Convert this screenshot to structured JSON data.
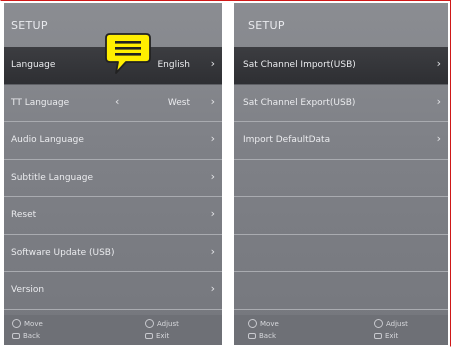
{
  "left_panel": {
    "title": "SETUP",
    "rows": [
      {
        "label": "Language",
        "value": "English",
        "selected": true
      },
      {
        "label": "TT Language",
        "value": "West",
        "selected": false
      },
      {
        "label": "Audio Language",
        "value": "",
        "selected": false
      },
      {
        "label": "Subtitle Language",
        "value": "",
        "selected": false
      },
      {
        "label": "Reset",
        "value": "",
        "selected": false
      },
      {
        "label": "Software Update (USB)",
        "value": "",
        "selected": false
      },
      {
        "label": "Version",
        "value": "",
        "selected": false
      }
    ],
    "footer": {
      "move": "Move",
      "adjust": "Adjust",
      "back": "Back",
      "exit": "Exit"
    }
  },
  "right_panel": {
    "title": "SETUP",
    "rows": [
      {
        "label": "Sat Channel Import(USB)"
      },
      {
        "label": "Sat Channel Export(USB)"
      },
      {
        "label": "Import DefaultData"
      },
      {
        "label": ""
      },
      {
        "label": ""
      },
      {
        "label": ""
      },
      {
        "label": ""
      }
    ],
    "footer": {
      "move": "Move",
      "adjust": "Adjust",
      "back": "Back",
      "exit": "Exit"
    }
  },
  "icons": {
    "arrow_right": "›",
    "arrow_left": "‹",
    "balloon": "speech-balloon-icon"
  },
  "colors": {
    "selected_row": "#2e2f33",
    "balloon_fill": "#ffee00",
    "frame_border": "#d01818"
  }
}
